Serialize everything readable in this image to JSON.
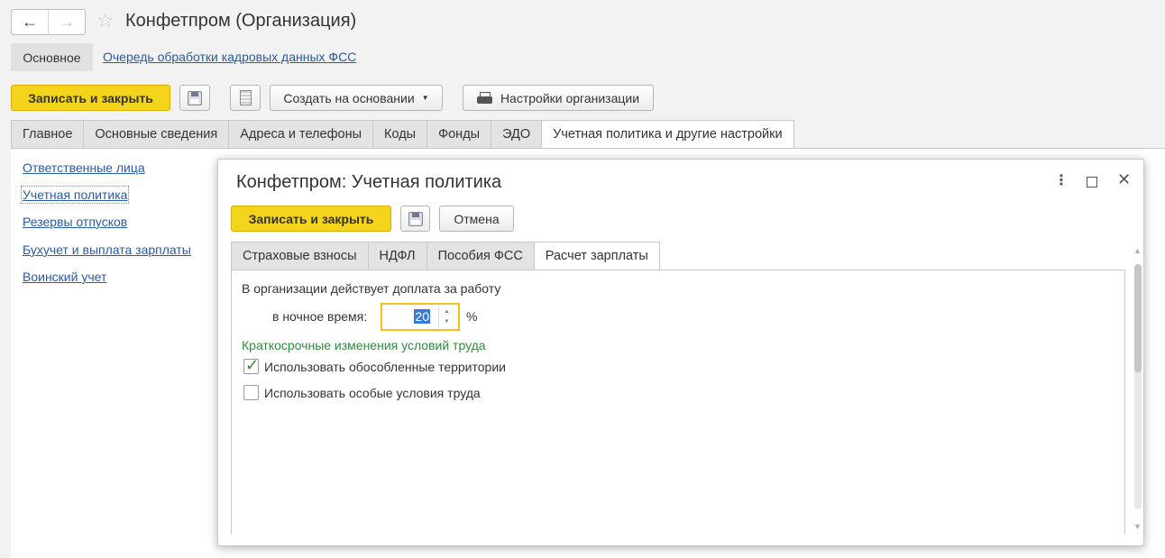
{
  "header": {
    "title": "Конфетпром (Организация)",
    "back_icon": "←",
    "forward_icon": "→",
    "star_icon": "☆"
  },
  "top_tabs": {
    "basic": "Основное",
    "queue_link": "Очередь обработки кадровых данных ФСС"
  },
  "toolbar": {
    "save_close": "Записать и закрыть",
    "create_based": "Создать на основании",
    "org_settings": "Настройки организации"
  },
  "main_tabs": [
    {
      "label": "Главное"
    },
    {
      "label": "Основные сведения"
    },
    {
      "label": "Адреса и телефоны"
    },
    {
      "label": "Коды"
    },
    {
      "label": "Фонды"
    },
    {
      "label": "ЭДО"
    },
    {
      "label": "Учетная политика и другие настройки"
    }
  ],
  "sidebar": {
    "items": [
      {
        "label": "Ответственные лица"
      },
      {
        "label": "Учетная политика"
      },
      {
        "label": "Резервы отпусков"
      },
      {
        "label": "Бухучет и выплата зарплаты"
      },
      {
        "label": "Воинский учет"
      }
    ]
  },
  "dialog": {
    "title": "Конфетпром: Учетная политика",
    "more_icon": "⋮",
    "close_icon": "✕",
    "save_close": "Записать и закрыть",
    "cancel": "Отмена",
    "tabs": [
      {
        "label": "Страховые взносы"
      },
      {
        "label": "НДФЛ"
      },
      {
        "label": "Пособия ФСС"
      },
      {
        "label": "Расчет зарплаты"
      }
    ],
    "supplement_label": "В организации действует доплата за работу",
    "night_label": "в ночное время:",
    "night_value": "20",
    "percent": "%",
    "section_heading": "Краткосрочные изменения условий труда",
    "checkbox_territories": {
      "label": "Использовать обособленные территории",
      "checked": true
    },
    "checkbox_special": {
      "label": "Использовать особые условия труда",
      "checked": false
    }
  },
  "colors": {
    "accent_yellow": "#f5d41c",
    "link_blue": "#2a5b9c",
    "green": "#2e8b3e"
  }
}
